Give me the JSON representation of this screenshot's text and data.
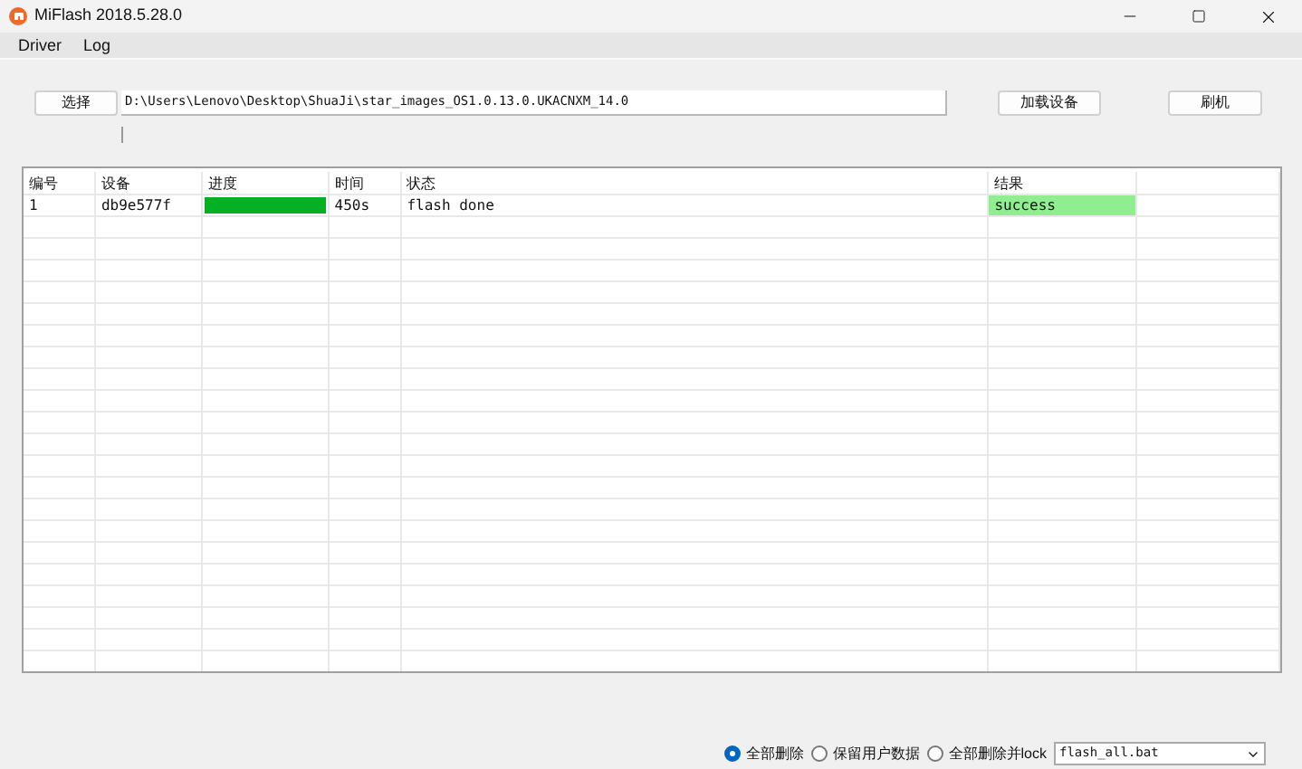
{
  "window": {
    "title": "MiFlash 2018.5.28.0"
  },
  "menu": [
    "Driver",
    "Log"
  ],
  "toolbar": {
    "select_button": "选择",
    "path": "D:\\Users\\Lenovo\\Desktop\\ShuaJi\\star_images_OS1.0.13.0.UKACNXM_14.0",
    "load_button": "加载设备",
    "flash_button": "刷机"
  },
  "table": {
    "columns": [
      "编号",
      "设备",
      "进度",
      "时间",
      "状态",
      "结果"
    ],
    "rows": [
      {
        "number": "1",
        "device": "db9e577f",
        "progress": {
          "level": 1
        },
        "time": "450s",
        "status": "flash done",
        "result": "success",
        "color": "#90ee90"
      }
    ]
  },
  "options": [
    {
      "label": "全部删除",
      "selected": true
    },
    {
      "label": "保留用户数据",
      "selected": false
    },
    {
      "label": "全部删除并lock",
      "selected": false
    }
  ],
  "script_select": {
    "value": "flash_all.bat"
  }
}
